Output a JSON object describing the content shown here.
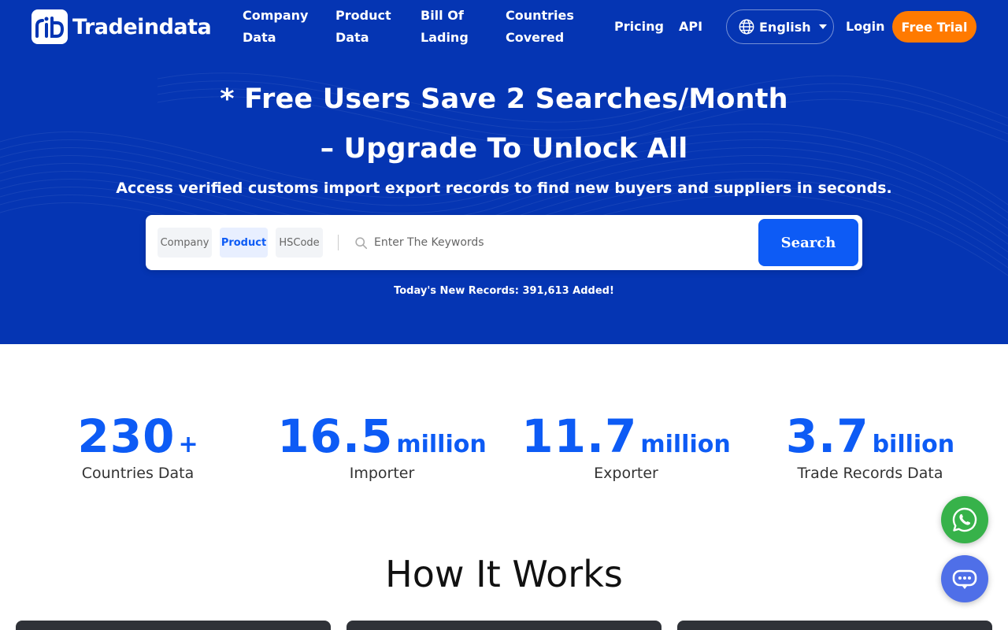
{
  "brand": {
    "name": "Tradeindata",
    "logo_icon": "tid-logo"
  },
  "nav": {
    "items": [
      {
        "label": "Company",
        "label2": "Data"
      },
      {
        "label": "Product",
        "label2": "Data"
      },
      {
        "label": "Bill Of",
        "label2": "Lading"
      },
      {
        "label": "Countries",
        "label2": "Covered"
      },
      {
        "label": "Pricing"
      },
      {
        "label": "API"
      }
    ],
    "language": {
      "label": "English",
      "icon": "globe-icon"
    },
    "login": "Login",
    "free_trial": "Free Trial"
  },
  "hero": {
    "headline_1": "* Free Users Save 2 Searches/Month",
    "headline_2": "– Upgrade To Unlock All",
    "subline": "Access verified customs import export records to find new buyers and suppliers in seconds.",
    "search": {
      "tabs": [
        "Company",
        "Product",
        "HSCode"
      ],
      "active_tab": "Product",
      "placeholder": "Enter The Keywords",
      "value": "",
      "button": "Search"
    },
    "records_text": "Today's New Records: 391,613 Added!"
  },
  "stats": [
    {
      "value": "230",
      "unit": "+",
      "label": "Countries Data"
    },
    {
      "value": "16.5",
      "unit": "million",
      "label": "Importer"
    },
    {
      "value": "11.7",
      "unit": "million",
      "label": "Exporter"
    },
    {
      "value": "3.7",
      "unit": "billion",
      "label": "Trade Records Data"
    }
  ],
  "how_it_works": {
    "title": "How It Works"
  },
  "floating": {
    "whatsapp_icon": "whatsapp-icon",
    "chat_icon": "chat-bot-icon"
  },
  "colors": {
    "hero_bg": "#0535b3",
    "accent": "#0d5bf5",
    "trial": "#ff7a00",
    "whatsapp": "#37b24a",
    "chat": "#4f6fe8"
  }
}
